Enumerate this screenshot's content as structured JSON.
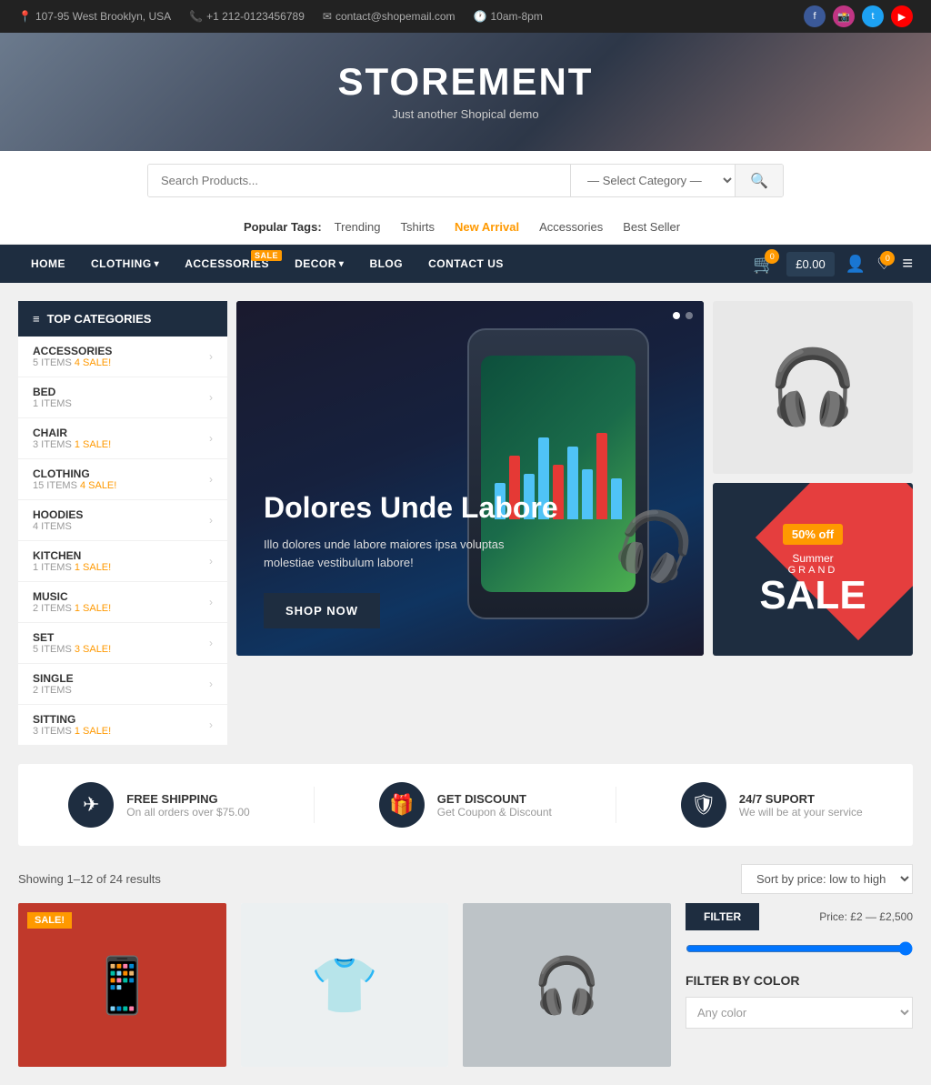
{
  "topbar": {
    "address": "107-95 West Brooklyn, USA",
    "phone": "+1 212-0123456789",
    "email": "contact@shopemail.com",
    "hours": "10am-8pm"
  },
  "hero": {
    "title": "STOREMENT",
    "subtitle": "Just another Shopical demo"
  },
  "search": {
    "placeholder": "Search Products...",
    "category_default": "— Select Category —"
  },
  "popular_tags": {
    "label": "Popular Tags:",
    "tags": [
      "Trending",
      "Tshirts",
      "New Arrival",
      "Accessories",
      "Best Seller"
    ]
  },
  "navbar": {
    "items": [
      "HOME",
      "CLOTHING",
      "ACCESSORIES",
      "DECOR",
      "BLOG",
      "CONTACT US"
    ],
    "sale_item": "ACCESSORIES",
    "cart_count": "0",
    "cart_price": "£0.00",
    "wish_count": "0"
  },
  "sidebar": {
    "header": "TOP CATEGORIES",
    "items": [
      {
        "name": "ACCESSORIES",
        "items": "5 ITEMS",
        "sale": "4 SALE!"
      },
      {
        "name": "BED",
        "items": "1 ITEMS",
        "sale": null
      },
      {
        "name": "CHAIR",
        "items": "3 ITEMS",
        "sale": "1 SALE!"
      },
      {
        "name": "CLOTHING",
        "items": "15 ITEMS",
        "sale": "4 SALE!"
      },
      {
        "name": "HOODIES",
        "items": "4 ITEMS",
        "sale": null
      },
      {
        "name": "KITCHEN",
        "items": "1 ITEMS",
        "sale": "1 SALE!"
      },
      {
        "name": "MUSIC",
        "items": "2 ITEMS",
        "sale": "1 SALE!"
      },
      {
        "name": "SET",
        "items": "5 ITEMS",
        "sale": "3 SALE!"
      },
      {
        "name": "SINGLE",
        "items": "2 ITEMS",
        "sale": null
      },
      {
        "name": "SITTING",
        "items": "3 ITEMS",
        "sale": "1 SALE!"
      }
    ]
  },
  "slider": {
    "title": "Dolores Unde Labore",
    "description": "Illo dolores unde labore maiores ipsa voluptas molestiae vestibulum labore!",
    "button": "SHOP NOW"
  },
  "sale_panel": {
    "off": "50% off",
    "summer": "Summer",
    "grand": "GRAND",
    "sale": "SALE"
  },
  "features": [
    {
      "icon": "✈",
      "title": "FREE SHIPPING",
      "sub": "On all orders over $75.00"
    },
    {
      "icon": "🎁",
      "title": "GET DISCOUNT",
      "sub": "Get Coupon & Discount"
    },
    {
      "icon": "🛡",
      "title": "24/7 SUPORT",
      "sub": "We will be at your service"
    }
  ],
  "products": {
    "results_text": "Showing 1–12 of 24 results",
    "sort_label": "Sort by price: low to high"
  },
  "filter": {
    "button": "FILTER",
    "price_range": "Price: £2 — £2,500",
    "color_header": "FILTER BY COLOR",
    "color_placeholder": "Any color"
  }
}
